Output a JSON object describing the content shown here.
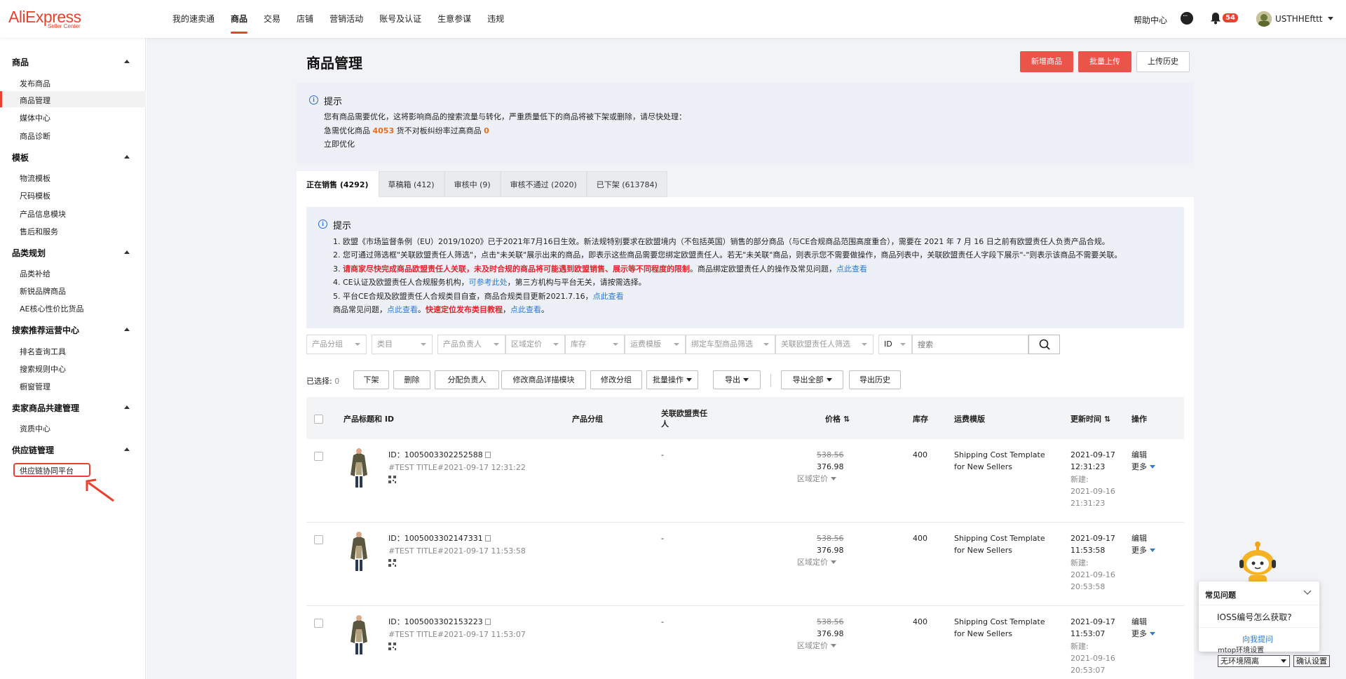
{
  "logo": {
    "main": "AliExpress",
    "sub": "Seller Center"
  },
  "nav": {
    "items": [
      "我的速卖通",
      "商品",
      "交易",
      "店铺",
      "营销活动",
      "账号及认证",
      "生意参谋",
      "违规"
    ],
    "active_index": 1,
    "help": "帮助中心",
    "badge": "54",
    "username": "USTHHEfttt"
  },
  "sidebar": {
    "s1": "商品",
    "s1_items": [
      "发布商品",
      "商品管理",
      "媒体中心",
      "商品诊断"
    ],
    "s2": "模板",
    "s2_items": [
      "物流模板",
      "尺码模板",
      "产品信息模块",
      "售后和服务"
    ],
    "s3": "品类规划",
    "s3_items": [
      "品类补给",
      "新锐品牌商品",
      "AE核心性价比货品"
    ],
    "s4": "搜索推荐运营中心",
    "s4_items": [
      "排名查询工具",
      "搜索规则中心",
      "橱窗管理"
    ],
    "s5": "卖家商品共建管理",
    "s5_items": [
      "资质中心"
    ],
    "s6": "供应链管理",
    "s6_items": [
      "供应链协同平台"
    ]
  },
  "page": {
    "title": "商品管理",
    "btn_new": "新增商品",
    "btn_batch": "批量上传",
    "btn_history": "上传历史"
  },
  "tip1": {
    "title": "提示",
    "line1": "您有商品需要优化，这将影响商品的搜索流量与转化，严重质量低下的商品将被下架或删除，请尽快处理：",
    "line2a": "急需优化商品",
    "count1": "4053",
    "line2b": "货不对板纠纷率过高商品",
    "count2": "0",
    "link": "立即优化"
  },
  "tabs": [
    "正在销售 (4292)",
    "草稿箱 (412)",
    "审核中 (9)",
    "审核不通过 (2020)",
    "已下架 (613784)"
  ],
  "tip2": {
    "title": "提示",
    "l1": "1. 欧盟《市场监督条例（EU）2019/1020》已于2021年7月16日生效。新法规特别要求在欧盟境内（不包括英国）销售的部分商品（与CE合规商品范围高度重合），需要在 2021 年 7 月 16 日之前有欧盟责任人负责产品合规。",
    "l2": "2. 您可通过筛选框\"关联欧盟责任人筛选\"，点击\"未关联\"展示出来的商品，即表示这些商品需要您绑定欧盟责任人。若无\"未关联\"商品，则表示您不需要做操作，商品列表中，关联欧盟责任人字段下展示\"-\"则表示该商品不需要关联。",
    "l3_pre": "3. ",
    "l3_red": "请商家尽快完成商品欧盟责任人关联，未及时合规的商品将可能遇到欧盟销售、展示等不同程度的限制",
    "l3_mid": "。商品绑定欧盟责任人的操作及常见问题，",
    "l3_link": "点此查看",
    "l4_pre": "4. CE认证及欧盟责任人合规服务机构，",
    "l4_link": "可参考此处",
    "l4_post": "，第三方机构与平台无关，请按需选择。",
    "l5_pre": "5. 平台CE合规及欧盟责任人合规类目自查，商品合规类目更新2021.7.16，",
    "l5_link": "点此查看",
    "l6_pre": "商品常见问题，",
    "l6_link1": "点此查看",
    "l6_sep": "。",
    "l6_red": "快速定位发布类目教程",
    "l6_comma": "，",
    "l6_link2": "点此查看",
    "l6_end": "。"
  },
  "filters": [
    "产品分组",
    "类目",
    "产品负责人",
    "区域定价",
    "库存",
    "运费模版",
    "绑定车型商品筛选",
    "关联欧盟责任人筛选",
    "ID"
  ],
  "search_placeholder": "搜索",
  "actions": {
    "selected_label": "已选择:",
    "selected_count": "0",
    "buttons": [
      "下架",
      "删除",
      "分配负责人",
      "修改商品详描模块",
      "修改分组",
      "批量操作",
      "导出",
      "导出全部",
      "导出历史"
    ]
  },
  "table": {
    "headers": [
      "产品标题和 ID",
      "产品分组",
      "关联欧盟责任人",
      "价格",
      "库存",
      "运费模版",
      "更新时间",
      "操作"
    ],
    "rows": [
      {
        "id": "ID：1005003302252588",
        "title": "#TEST TITLE#2021-09-17 12:31:22",
        "eu": "-",
        "orig_price": "538.56",
        "price": "376.98",
        "region": "区域定价",
        "stock": "400",
        "shipping": "Shipping Cost Template for New Sellers",
        "updated": "2021-09-17 12:31:23",
        "created_label": "新建:",
        "created": "2021-09-16 21:31:23",
        "edit": "编辑",
        "more": "更多"
      },
      {
        "id": "ID：1005003302147331",
        "title": "#TEST TITLE#2021-09-17 11:53:58",
        "eu": "-",
        "orig_price": "538.56",
        "price": "376.98",
        "region": "区域定价",
        "stock": "400",
        "shipping": "Shipping Cost Template for New Sellers",
        "updated": "2021-09-17 11:53:58",
        "created_label": "新建:",
        "created": "2021-09-16 20:53:58",
        "edit": "编辑",
        "more": "更多"
      },
      {
        "id": "ID：1005003302153223",
        "title": "#TEST TITLE#2021-09-17 11:53:07",
        "eu": "-",
        "orig_price": "538.56",
        "price": "376.98",
        "region": "区域定价",
        "stock": "400",
        "shipping": "Shipping Cost Template for New Sellers",
        "updated": "2021-09-17 11:53:07",
        "created_label": "新建:",
        "created": "2021-09-16 20:53:07",
        "edit": "编辑",
        "more": "更多"
      }
    ]
  },
  "faq": {
    "title": "常见问题",
    "question": "IOSS编号怎么获取?",
    "ask": "向我提问",
    "partial": "mtop环境设置",
    "select": "无环境隔离",
    "confirm": "确认设置"
  },
  "colors": {
    "brand": "#e8412d",
    "link": "#2d7cd6",
    "count": "#e86c1d",
    "warn": "#e8222b"
  }
}
